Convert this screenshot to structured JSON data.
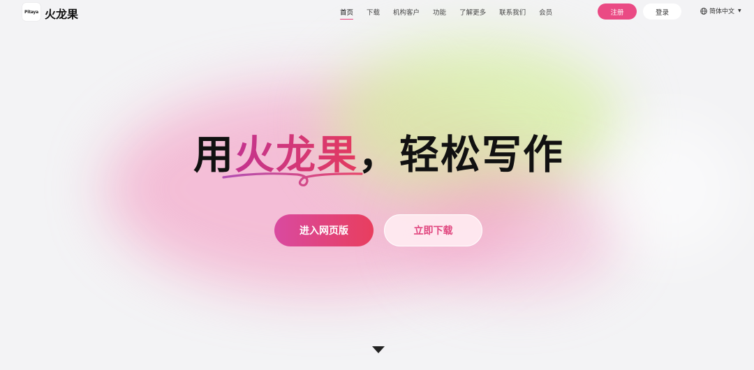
{
  "brand": {
    "logo_text": "Pitaya",
    "name": "火龙果"
  },
  "nav": {
    "items": [
      {
        "label": "首页",
        "active": true
      },
      {
        "label": "下载"
      },
      {
        "label": "机构客户"
      },
      {
        "label": "功能"
      },
      {
        "label": "了解更多"
      },
      {
        "label": "联系我们"
      },
      {
        "label": "会员"
      }
    ],
    "register_label": "注册",
    "login_label": "登录",
    "language": "简体中文",
    "language_icon": "globe-icon"
  },
  "hero": {
    "title_prefix": "用",
    "title_highlight": "火龙果",
    "title_suffix": "，轻松写作",
    "primary_button": "进入网页版",
    "secondary_button": "立即下载"
  },
  "colors": {
    "accent": "#ea4a84",
    "gradient_start": "#d94aa0",
    "gradient_end": "#e83e5e"
  },
  "scroll_icon": "triangle-down-icon"
}
